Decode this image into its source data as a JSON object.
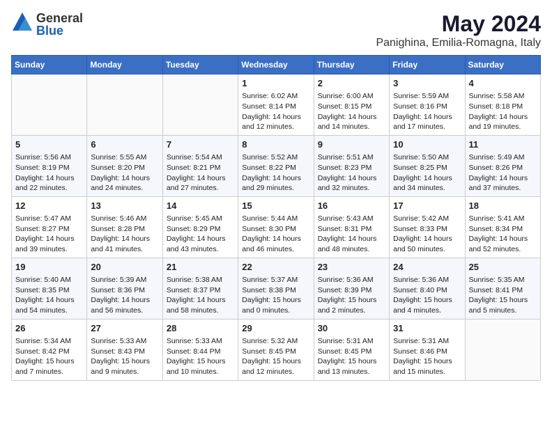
{
  "header": {
    "logo_general": "General",
    "logo_blue": "Blue",
    "month_year": "May 2024",
    "location": "Panighina, Emilia-Romagna, Italy"
  },
  "weekdays": [
    "Sunday",
    "Monday",
    "Tuesday",
    "Wednesday",
    "Thursday",
    "Friday",
    "Saturday"
  ],
  "weeks": [
    [
      {
        "day": "",
        "content": ""
      },
      {
        "day": "",
        "content": ""
      },
      {
        "day": "",
        "content": ""
      },
      {
        "day": "1",
        "content": "Sunrise: 6:02 AM\nSunset: 8:14 PM\nDaylight: 14 hours\nand 12 minutes."
      },
      {
        "day": "2",
        "content": "Sunrise: 6:00 AM\nSunset: 8:15 PM\nDaylight: 14 hours\nand 14 minutes."
      },
      {
        "day": "3",
        "content": "Sunrise: 5:59 AM\nSunset: 8:16 PM\nDaylight: 14 hours\nand 17 minutes."
      },
      {
        "day": "4",
        "content": "Sunrise: 5:58 AM\nSunset: 8:18 PM\nDaylight: 14 hours\nand 19 minutes."
      }
    ],
    [
      {
        "day": "5",
        "content": "Sunrise: 5:56 AM\nSunset: 8:19 PM\nDaylight: 14 hours\nand 22 minutes."
      },
      {
        "day": "6",
        "content": "Sunrise: 5:55 AM\nSunset: 8:20 PM\nDaylight: 14 hours\nand 24 minutes."
      },
      {
        "day": "7",
        "content": "Sunrise: 5:54 AM\nSunset: 8:21 PM\nDaylight: 14 hours\nand 27 minutes."
      },
      {
        "day": "8",
        "content": "Sunrise: 5:52 AM\nSunset: 8:22 PM\nDaylight: 14 hours\nand 29 minutes."
      },
      {
        "day": "9",
        "content": "Sunrise: 5:51 AM\nSunset: 8:23 PM\nDaylight: 14 hours\nand 32 minutes."
      },
      {
        "day": "10",
        "content": "Sunrise: 5:50 AM\nSunset: 8:25 PM\nDaylight: 14 hours\nand 34 minutes."
      },
      {
        "day": "11",
        "content": "Sunrise: 5:49 AM\nSunset: 8:26 PM\nDaylight: 14 hours\nand 37 minutes."
      }
    ],
    [
      {
        "day": "12",
        "content": "Sunrise: 5:47 AM\nSunset: 8:27 PM\nDaylight: 14 hours\nand 39 minutes."
      },
      {
        "day": "13",
        "content": "Sunrise: 5:46 AM\nSunset: 8:28 PM\nDaylight: 14 hours\nand 41 minutes."
      },
      {
        "day": "14",
        "content": "Sunrise: 5:45 AM\nSunset: 8:29 PM\nDaylight: 14 hours\nand 43 minutes."
      },
      {
        "day": "15",
        "content": "Sunrise: 5:44 AM\nSunset: 8:30 PM\nDaylight: 14 hours\nand 46 minutes."
      },
      {
        "day": "16",
        "content": "Sunrise: 5:43 AM\nSunset: 8:31 PM\nDaylight: 14 hours\nand 48 minutes."
      },
      {
        "day": "17",
        "content": "Sunrise: 5:42 AM\nSunset: 8:33 PM\nDaylight: 14 hours\nand 50 minutes."
      },
      {
        "day": "18",
        "content": "Sunrise: 5:41 AM\nSunset: 8:34 PM\nDaylight: 14 hours\nand 52 minutes."
      }
    ],
    [
      {
        "day": "19",
        "content": "Sunrise: 5:40 AM\nSunset: 8:35 PM\nDaylight: 14 hours\nand 54 minutes."
      },
      {
        "day": "20",
        "content": "Sunrise: 5:39 AM\nSunset: 8:36 PM\nDaylight: 14 hours\nand 56 minutes."
      },
      {
        "day": "21",
        "content": "Sunrise: 5:38 AM\nSunset: 8:37 PM\nDaylight: 14 hours\nand 58 minutes."
      },
      {
        "day": "22",
        "content": "Sunrise: 5:37 AM\nSunset: 8:38 PM\nDaylight: 15 hours\nand 0 minutes."
      },
      {
        "day": "23",
        "content": "Sunrise: 5:36 AM\nSunset: 8:39 PM\nDaylight: 15 hours\nand 2 minutes."
      },
      {
        "day": "24",
        "content": "Sunrise: 5:36 AM\nSunset: 8:40 PM\nDaylight: 15 hours\nand 4 minutes."
      },
      {
        "day": "25",
        "content": "Sunrise: 5:35 AM\nSunset: 8:41 PM\nDaylight: 15 hours\nand 5 minutes."
      }
    ],
    [
      {
        "day": "26",
        "content": "Sunrise: 5:34 AM\nSunset: 8:42 PM\nDaylight: 15 hours\nand 7 minutes."
      },
      {
        "day": "27",
        "content": "Sunrise: 5:33 AM\nSunset: 8:43 PM\nDaylight: 15 hours\nand 9 minutes."
      },
      {
        "day": "28",
        "content": "Sunrise: 5:33 AM\nSunset: 8:44 PM\nDaylight: 15 hours\nand 10 minutes."
      },
      {
        "day": "29",
        "content": "Sunrise: 5:32 AM\nSunset: 8:45 PM\nDaylight: 15 hours\nand 12 minutes."
      },
      {
        "day": "30",
        "content": "Sunrise: 5:31 AM\nSunset: 8:45 PM\nDaylight: 15 hours\nand 13 minutes."
      },
      {
        "day": "31",
        "content": "Sunrise: 5:31 AM\nSunset: 8:46 PM\nDaylight: 15 hours\nand 15 minutes."
      },
      {
        "day": "",
        "content": ""
      }
    ]
  ]
}
